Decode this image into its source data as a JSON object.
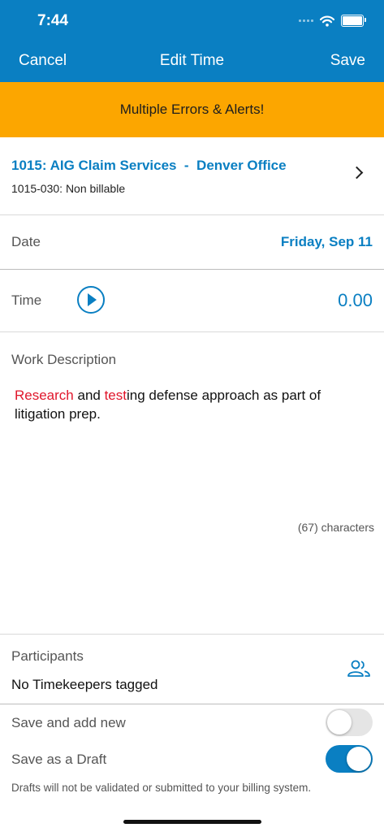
{
  "status_bar": {
    "time": "7:44"
  },
  "nav": {
    "cancel_label": "Cancel",
    "title": "Edit Time",
    "save_label": "Save"
  },
  "alert": {
    "text": "Multiple Errors & Alerts!",
    "color": "#fca600"
  },
  "matter": {
    "title": "1015: AIG Claim Services  -  Denver Office",
    "subtitle": "1015-030: Non billable"
  },
  "date": {
    "label": "Date",
    "value": "Friday, Sep 11"
  },
  "time": {
    "label": "Time",
    "value": "0.00"
  },
  "work_description": {
    "label": "Work Description",
    "segments": [
      {
        "text": "Research",
        "flagged": true
      },
      {
        "text": " and ",
        "flagged": false
      },
      {
        "text": "test",
        "flagged": true
      },
      {
        "text": "ing defense approach as part of litigation prep.",
        "flagged": false
      }
    ],
    "char_count": "(67) characters"
  },
  "participants": {
    "label": "Participants",
    "value": "No Timekeepers tagged"
  },
  "toggles": {
    "save_and_add_new": {
      "label": "Save and add new",
      "on": false
    },
    "save_as_draft": {
      "label": "Save as a Draft",
      "on": true
    }
  },
  "draft_note": "Drafts will not be validated or submitted to your billing system.",
  "colors": {
    "accent": "#0a7fc2",
    "error": "#e0162b"
  }
}
